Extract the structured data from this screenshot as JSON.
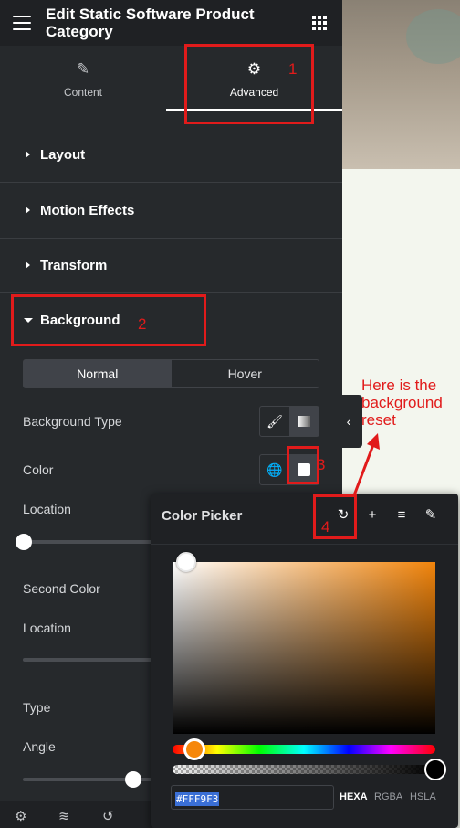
{
  "header": {
    "title": "Edit Static Software Product Category"
  },
  "tabs": [
    {
      "label": "Content",
      "icon": "pencil-icon",
      "active": false
    },
    {
      "label": "Advanced",
      "icon": "gear-icon",
      "active": true
    }
  ],
  "sections": {
    "layout": "Layout",
    "motion": "Motion Effects",
    "transform": "Transform",
    "background": "Background"
  },
  "background": {
    "normal_tab": "Normal",
    "hover_tab": "Hover",
    "type_label": "Background Type",
    "color_label": "Color",
    "location_label": "Location",
    "second_color_label": "Second Color",
    "location2_label": "Location",
    "type2_label": "Type",
    "angle_label": "Angle"
  },
  "color_picker": {
    "title": "Color Picker",
    "hex_value": "#FFF9F3",
    "formats": [
      "HEXA",
      "RGBA",
      "HSLA"
    ],
    "hue_color": "#f1840b"
  },
  "annotations": {
    "n1": "1",
    "n2": "2",
    "n3": "3",
    "n4": "4",
    "note": "Here is the background reset",
    "color": "#e11b1b"
  }
}
